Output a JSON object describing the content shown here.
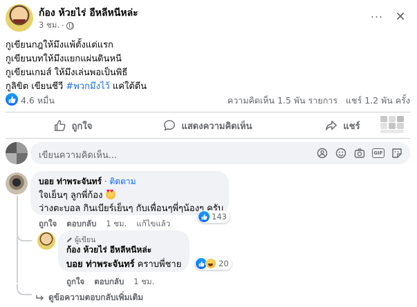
{
  "post": {
    "author": "ก้อง ห้วยไร่ อีหลีหนีหล่ะ",
    "time": "3 ชม.",
    "more": "···",
    "close": "✕",
    "lines": [
      "กูเขียนกฎให้มึงแพ้ตั้งแต่แรก",
      "กูเขียนบทให้มึงแยกแผ่นดินหนี",
      "กูเขียนเกมส์ ให้มึงเล่นพอเป็นพิธี",
      "กูลิขิต เขียนชีวี"
    ],
    "line4_hashtag": "#พวกมึงไว้",
    "line4_tail": " แค่ใต้ตีน",
    "reactions": "4.6 หมื่น",
    "comments_stat": "ความคิดเห็น 1.5 พัน รายการ",
    "shares_stat": "แชร์ 1.2 พัน ครั้ง"
  },
  "actions": {
    "like": "ถูกใจ",
    "comment": "แสดงความคิดเห็น",
    "share": "แชร์"
  },
  "composer": {
    "placeholder": "เขียนความคิดเห็น..."
  },
  "comments": [
    {
      "name": "บอย ท่าพระจันทร์",
      "follow": " · ติดตาม",
      "line1": "ใจเย็นๆ ลูกพี่ก้อง",
      "line2": "ว่างตะบอล กินเบียร์เย็นๆ กับเพื่อนๆพี่ๆน้องๆ ครับ",
      "like": "ถูกใจ",
      "reply": "ตอบกลับ",
      "time": "1 ชม.",
      "edited": "แก้ไขแล้ว",
      "reaction_count": "143"
    }
  ],
  "reply": {
    "author_tag": "ผู้เขียน",
    "name": "ก้อง ห้วยไร่ อีหลีหนีหล่ะ",
    "mention": "บอย ท่าพระจันทร์",
    "text": " คราบพี่ชาย",
    "like": "ถูกใจ",
    "reply": "ตอบกลับ",
    "time": "1 ชม.",
    "reaction_count": "20"
  },
  "view_more": "ดูข้อความตอบกลับเพิ่มเติม",
  "colors": {
    "accent": "#0866ff",
    "hashtag": "#216fdb",
    "secondary_text": "#65676b",
    "bubble": "#f0f2f5"
  }
}
